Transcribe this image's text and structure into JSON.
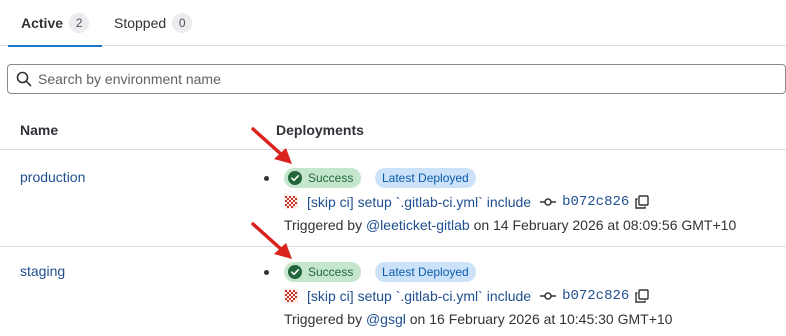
{
  "tabs": [
    {
      "label": "Active",
      "count": "2"
    },
    {
      "label": "Stopped",
      "count": "0"
    }
  ],
  "search": {
    "placeholder": "Search by environment name"
  },
  "table": {
    "headers": {
      "name": "Name",
      "deployments": "Deployments"
    },
    "rows": [
      {
        "name": "production",
        "status": "Success",
        "latest_badge": "Latest Deployed",
        "commit_title": "[skip ci] setup `.gitlab-ci.yml` include",
        "commit_sha": "b072c826",
        "triggered_prefix": "Triggered by",
        "user": "@leeticket-gitlab",
        "date_text": "on 14 February 2026 at 08:09:56 GMT+10"
      },
      {
        "name": "staging",
        "status": "Success",
        "latest_badge": "Latest Deployed",
        "commit_title": "[skip ci] setup `.gitlab-ci.yml` include",
        "commit_sha": "b072c826",
        "triggered_prefix": "Triggered by",
        "user": "@gsgl",
        "date_text": "on 16 February 2026 at 10:45:30 GMT+10"
      }
    ]
  },
  "colors": {
    "link": "#1f4f8f",
    "success_bg": "#c3e6cd",
    "success_fg": "#24663b",
    "latest_bg": "#cbe2f9",
    "latest_fg": "#0b5cad",
    "arrow": "#d9231c",
    "tab_underline": "#1f75cb"
  },
  "icons": {
    "search": "search-icon",
    "success": "check-circle-icon",
    "commit_avatar": "pattern-avatar-icon",
    "commit": "commit-icon",
    "copy": "copy-icon",
    "annotation_arrow": "red-arrow-icon"
  }
}
